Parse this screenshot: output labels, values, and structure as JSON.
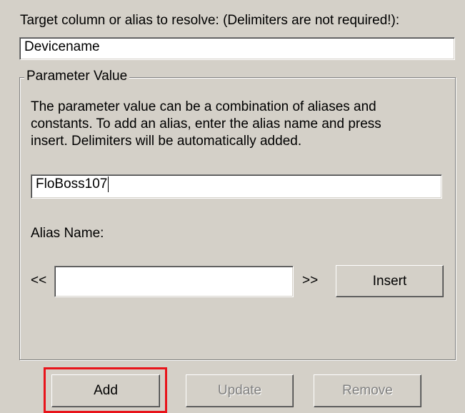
{
  "target": {
    "label": "Target column or alias to resolve: (Delimiters are not required!):",
    "value": "Devicename"
  },
  "parameter_group": {
    "legend": "Parameter Value",
    "description_lines": [
      "The parameter value can be a combination of aliases and",
      "constants. To add an alias, enter the alias name and press",
      "insert. Delimiters will be automatically added."
    ],
    "value": "FloBoss107",
    "alias_label": "Alias Name:",
    "prev_label": "<<",
    "next_label": ">>",
    "alias_value": "",
    "insert_label": "Insert"
  },
  "buttons": {
    "add": "Add",
    "update": "Update",
    "remove": "Remove"
  },
  "colors": {
    "background": "#d4d0c8",
    "highlight": "#e8141b",
    "disabled_text": "#808080"
  }
}
